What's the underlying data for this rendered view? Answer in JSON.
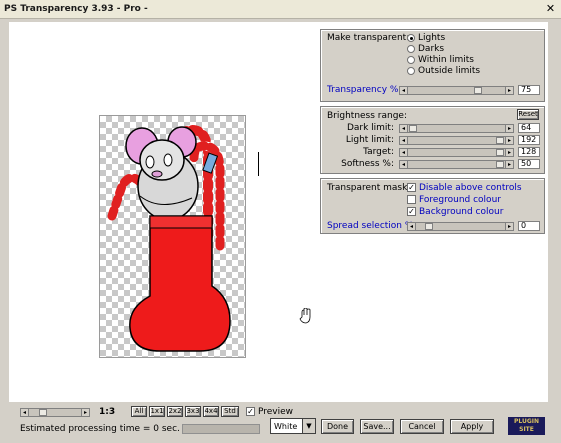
{
  "window": {
    "title": "PS Transparency 3.93 - Pro -"
  },
  "make_transparent": {
    "label": "Make transparent:",
    "options": [
      "Lights",
      "Darks",
      "Within limits",
      "Outside limits"
    ],
    "selected": 0
  },
  "transparency": {
    "label": "Transparency %:",
    "value": "75",
    "level": 0.75
  },
  "brightness": {
    "label": "Brightness range:",
    "reset_label": "Reset",
    "rows": [
      {
        "label": "Dark limit:",
        "value": "64",
        "level": 0.0
      },
      {
        "label": "Light limit:",
        "value": "192",
        "level": 1.0
      },
      {
        "label": "Target:",
        "value": "128",
        "level": 1.0
      },
      {
        "label": "Softness %:",
        "value": "50",
        "level": 1.0
      }
    ]
  },
  "transparent_mask": {
    "label": "Transparent mask:",
    "options": [
      {
        "label": "Disable above controls",
        "checked": true
      },
      {
        "label": "Foreground colour",
        "checked": false
      },
      {
        "label": "Background colour",
        "checked": true
      }
    ]
  },
  "spread": {
    "label": "Spread selection %:",
    "value": "0",
    "level": 0.1
  },
  "toolbar": {
    "zoom_text": "1:3",
    "zoom_buttons": [
      "All",
      "1x1",
      "2x2",
      "3x3",
      "4x4",
      "Std"
    ],
    "preview_label": "Preview",
    "preview_checked": true
  },
  "status": {
    "text": "Estimated processing time = 0 sec."
  },
  "bg_select": {
    "value": "White"
  },
  "buttons": {
    "done": "Done",
    "save": "Save...",
    "cancel": "Cancel",
    "apply": "Apply"
  },
  "logo": {
    "line1": "PLUGIN",
    "line2": "SITE"
  }
}
